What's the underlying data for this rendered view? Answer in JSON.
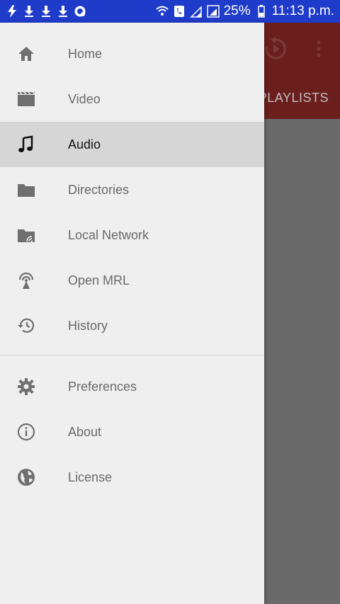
{
  "status_bar": {
    "battery_percent": "25%",
    "time": "11:13 p.m.",
    "left_icons": [
      "flash-icon",
      "download-icon",
      "download-icon",
      "download-icon",
      "whatsapp-icon"
    ],
    "right_icons": [
      "wifi-icon",
      "call-icon",
      "signal-icon",
      "signal-box-icon",
      "battery-icon"
    ]
  },
  "app_bar": {
    "color": "#6b1f1d",
    "tab_label": "PLAYLISTS"
  },
  "drawer": {
    "items": [
      {
        "label": "Home",
        "icon": "home-icon"
      },
      {
        "label": "Video",
        "icon": "video-icon"
      },
      {
        "label": "Audio",
        "icon": "music-note-icon",
        "selected": true
      },
      {
        "label": "Directories",
        "icon": "folder-icon"
      },
      {
        "label": "Local Network",
        "icon": "network-folder-icon"
      },
      {
        "label": "Open MRL",
        "icon": "stream-icon"
      },
      {
        "label": "History",
        "icon": "history-icon"
      }
    ],
    "secondary": [
      {
        "label": "Preferences",
        "icon": "gear-icon"
      },
      {
        "label": "About",
        "icon": "info-icon"
      },
      {
        "label": "License",
        "icon": "globe-icon"
      }
    ]
  }
}
